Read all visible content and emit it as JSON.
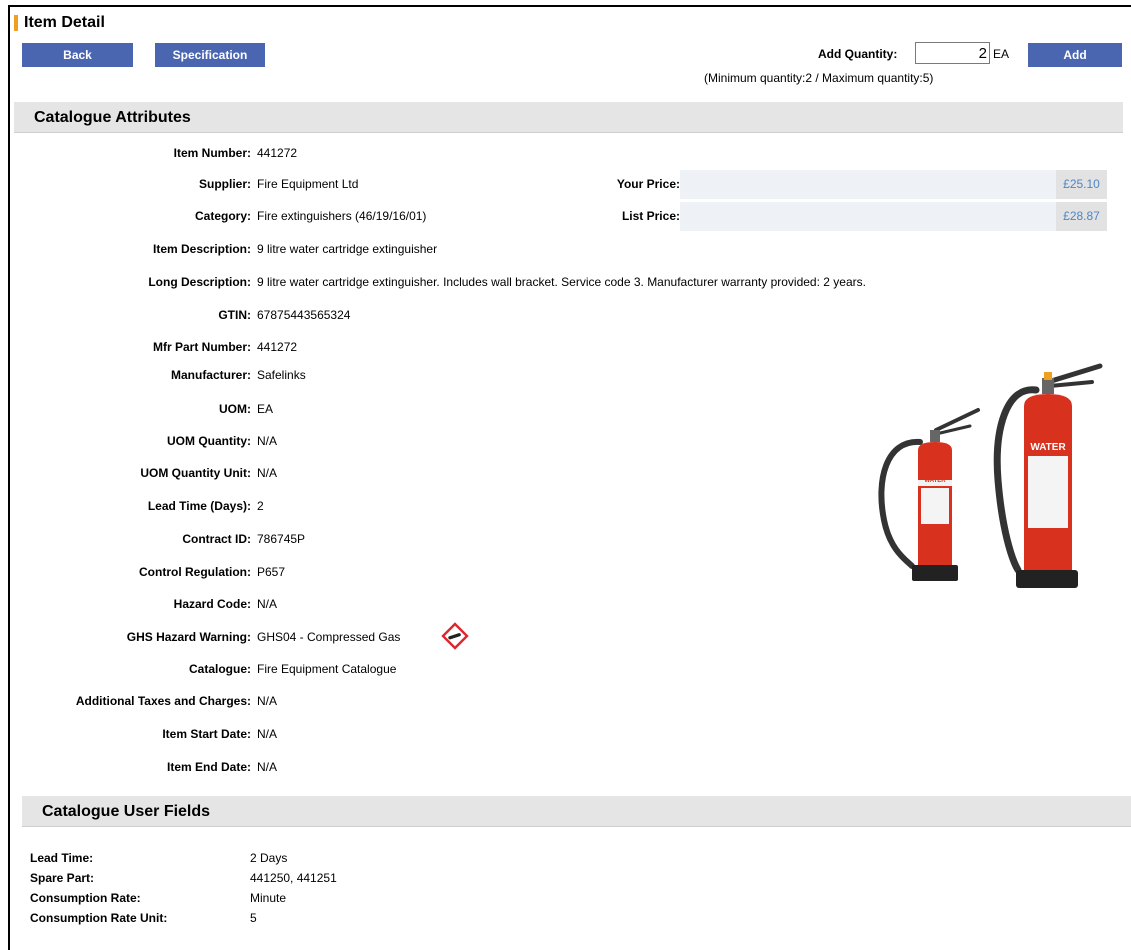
{
  "page": {
    "title": "Item Detail"
  },
  "toolbar": {
    "back_label": "Back",
    "specification_label": "Specification",
    "add_quantity_label": "Add Quantity:",
    "quantity_value": "2",
    "quantity_uom": "EA",
    "add_label": "Add",
    "quantity_note": "(Minimum quantity:2  /  Maximum quantity:5)"
  },
  "catalogue_attributes": {
    "title": "Catalogue Attributes",
    "rows": [
      {
        "label": "Item Number:",
        "value": "441272"
      },
      {
        "label": "Supplier:",
        "value": "Fire Equipment Ltd"
      },
      {
        "label": "Category:",
        "value": "Fire extinguishers (46/19/16/01)"
      },
      {
        "label": "Item Description:",
        "value": "9 litre water cartridge extinguisher"
      },
      {
        "label": "Long Description:",
        "value": "9 litre water cartridge extinguisher. Includes wall bracket. Service code 3. Manufacturer warranty provided: 2 years."
      },
      {
        "label": "GTIN:",
        "value": "67875443565324"
      },
      {
        "label": "Mfr Part Number:",
        "value": "441272"
      },
      {
        "label": "Manufacturer:",
        "value": "Safelinks"
      },
      {
        "label": "UOM:",
        "value": "EA"
      },
      {
        "label": "UOM Quantity:",
        "value": "N/A"
      },
      {
        "label": "UOM Quantity Unit:",
        "value": "N/A"
      },
      {
        "label": "Lead Time (Days):",
        "value": "2"
      },
      {
        "label": "Contract ID:",
        "value": "786745P"
      },
      {
        "label": "Control Regulation:",
        "value": "P657"
      },
      {
        "label": "Hazard Code:",
        "value": "N/A"
      },
      {
        "label": "GHS Hazard Warning:",
        "value": "GHS04 - Compressed Gas"
      },
      {
        "label": "Catalogue:",
        "value": "Fire Equipment Catalogue"
      },
      {
        "label": "Additional Taxes and Charges:",
        "value": "N/A"
      },
      {
        "label": "Item Start Date:",
        "value": "N/A"
      },
      {
        "label": "Item End Date:",
        "value": "N/A"
      }
    ],
    "prices": {
      "your_price_label": "Your Price:",
      "your_price_value": "£25.10",
      "list_price_label": "List Price:",
      "list_price_value": "£28.87"
    },
    "product_image": {
      "label_text": "WATER",
      "color": "#d8321e"
    }
  },
  "user_fields": {
    "title": "Catalogue User Fields",
    "rows": [
      {
        "label": "Lead Time:",
        "value": "2 Days"
      },
      {
        "label": "Spare Part:",
        "value": "441250, 441251"
      },
      {
        "label": "Consumption Rate:",
        "value": "Minute"
      },
      {
        "label": "Consumption Rate Unit:",
        "value": "5"
      }
    ]
  },
  "colors": {
    "button": "#4a66b0",
    "title_accent": "#f0a020",
    "price_text": "#4d86c6",
    "ghs_diamond": "#e0262d"
  }
}
